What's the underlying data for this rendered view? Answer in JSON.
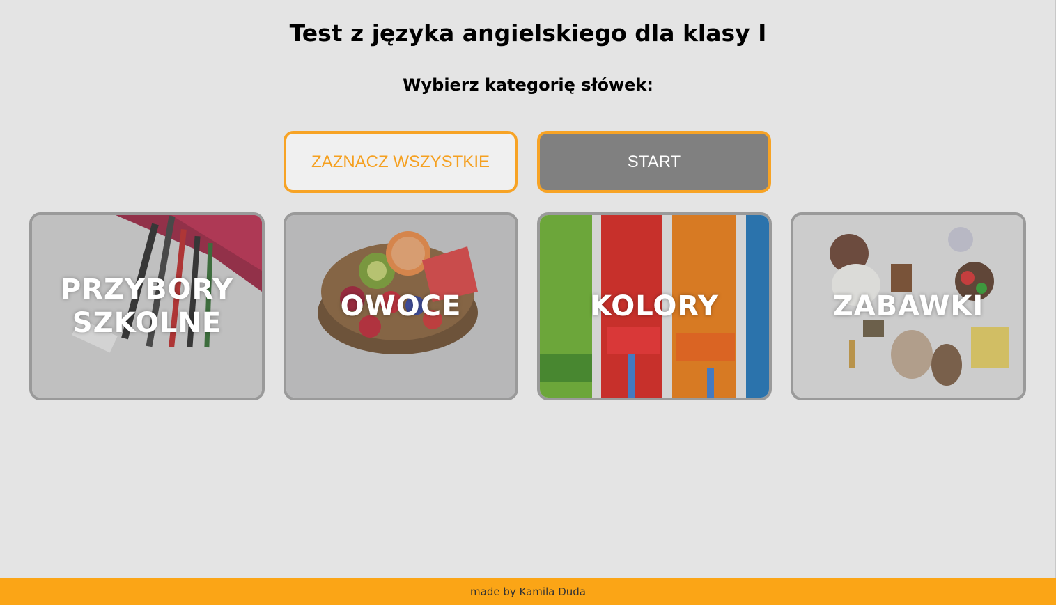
{
  "header": {
    "title": "Test z języka angielskiego dla klasy I",
    "subtitle": "Wybierz kategorię słówek:"
  },
  "buttons": {
    "select_all_label": "ZAZNACZ WSZYSTKIE",
    "start_label": "START"
  },
  "categories": [
    {
      "label": "PRZYBORY\nSZKOLNE",
      "image": "school-supplies-photo"
    },
    {
      "label": "OWOCE",
      "image": "fruit-bowl-photo"
    },
    {
      "label": "KOLORY",
      "image": "paint-stripes-photo"
    },
    {
      "label": "ZABAWKI",
      "image": "toys-photo"
    }
  ],
  "footer": {
    "text": "made by  Kamila Duda"
  },
  "colors": {
    "accent": "#f7a325",
    "background": "#e4e4e4",
    "start_button_bg": "#808080",
    "footer_bg": "#fba516"
  }
}
